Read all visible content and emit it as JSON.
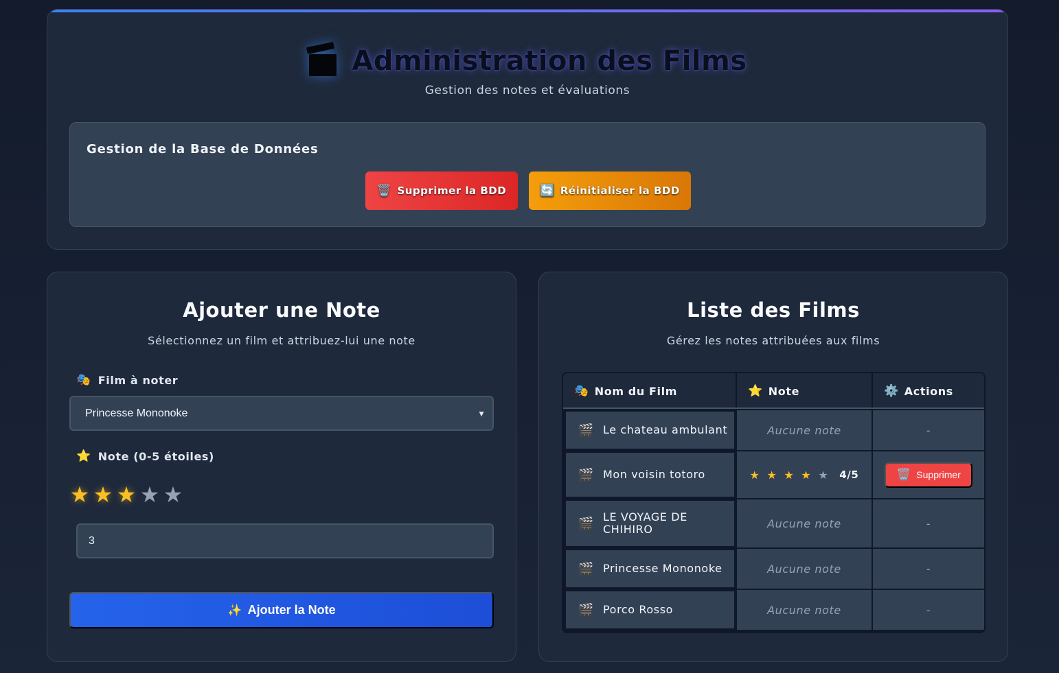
{
  "header": {
    "icon": "clapperboard-icon",
    "title": "Administration des Films",
    "subtitle": "Gestion des notes et évaluations"
  },
  "db_management": {
    "title": "Gestion de la Base de Données",
    "delete_button": {
      "icon": "wastebasket-icon",
      "emoji": "🗑️",
      "label": "Supprimer la BDD"
    },
    "reset_button": {
      "icon": "refresh-icon",
      "emoji": "🔄",
      "label": "Réinitialiser la BDD"
    }
  },
  "add_note": {
    "title": "Ajouter une Note",
    "subtitle": "Sélectionnez un film et attribuez-lui une note",
    "film_label": {
      "icon": "theater-masks-icon",
      "emoji": "🎭",
      "text": "Film à noter"
    },
    "film_select_value": "Princesse Mononoke",
    "note_label": {
      "icon": "star-icon",
      "emoji": "⭐",
      "text": "Note (0-5 étoiles)"
    },
    "rating": 3,
    "max_rating": 5,
    "star_glyph": "★",
    "note_input_value": "3",
    "submit_button": {
      "icon": "sparkles-icon",
      "emoji": "✨",
      "label": "Ajouter la Note"
    }
  },
  "films_list": {
    "title": "Liste des Films",
    "subtitle": "Gérez les notes attribuées aux films",
    "columns": [
      {
        "icon": "theater-masks-icon",
        "emoji": "🎭",
        "label": "Nom du Film"
      },
      {
        "icon": "star-icon",
        "emoji": "⭐",
        "label": "Note"
      },
      {
        "icon": "gear-icon",
        "emoji": "⚙️",
        "label": "Actions"
      }
    ],
    "film_icon": "clapperboard-icon",
    "film_emoji": "🎬",
    "rows": [
      {
        "name": "Le chateau ambulant",
        "note_text": "Aucune note",
        "rating": null,
        "action": "-"
      },
      {
        "name": "Mon voisin totoro",
        "note_text": "4/5",
        "rating": 4,
        "action_button": {
          "emoji": "🗑️",
          "label": "Supprimer"
        }
      },
      {
        "name": "LE VOYAGE DE CHIHIRO",
        "note_text": "Aucune note",
        "rating": null,
        "action": "-"
      },
      {
        "name": "Princesse Mononoke",
        "note_text": "Aucune note",
        "rating": null,
        "action": "-"
      },
      {
        "name": "Porco Rosso",
        "note_text": "Aucune note",
        "rating": null,
        "action": "-"
      }
    ]
  },
  "colors": {
    "accent_blue": "#2563eb",
    "danger": "#ef4444",
    "warning": "#f59e0b",
    "star": "#fbbf24"
  }
}
